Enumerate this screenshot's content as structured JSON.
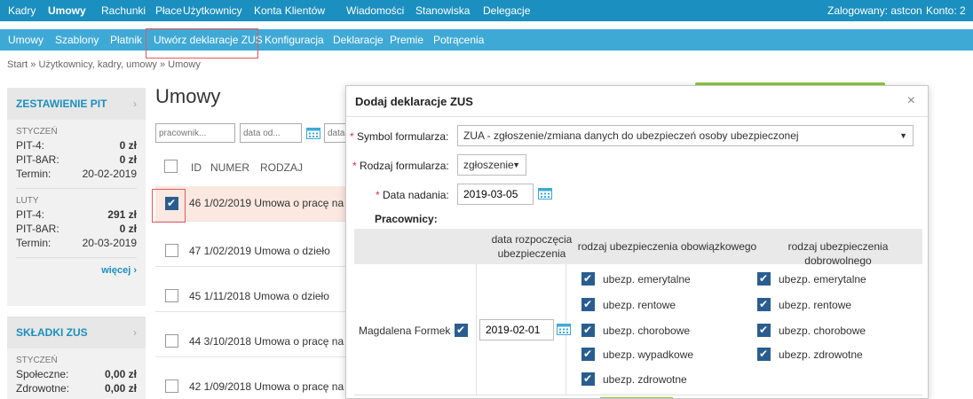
{
  "topnav": {
    "items": [
      "Kadry",
      "Umowy",
      "Rachunki",
      "Płace",
      "Użytkownicy",
      "Konta Klientów",
      "Wiadomości",
      "Stanowiska",
      "Delegacje"
    ],
    "user": "Zalogowany: astcon",
    "account": "Konto: 2"
  },
  "subnav": {
    "items": [
      "Umowy",
      "Szablony",
      "Płatnik",
      "Utwórz deklaracje ZUS",
      "Konfiguracja",
      "Deklaracje",
      "Premie",
      "Potrącenia"
    ]
  },
  "breadcrumb": "Start » Użytkownicy, kadry, umowy » Umowy",
  "pit": {
    "title": "ZESTAWIENIE PIT",
    "months": [
      {
        "name": "STYCZEŃ",
        "rows": [
          [
            "PIT-4:",
            "0 zł"
          ],
          [
            "PIT-8AR:",
            "0 zł"
          ],
          [
            "Termin:",
            "20-02-2019"
          ]
        ]
      },
      {
        "name": "LUTY",
        "rows": [
          [
            "PIT-4:",
            "291 zł"
          ],
          [
            "PIT-8AR:",
            "0 zł"
          ],
          [
            "Termin:",
            "20-03-2019"
          ]
        ]
      }
    ],
    "more": "więcej ›"
  },
  "zus": {
    "title": "SKŁADKI ZUS",
    "months": [
      {
        "name": "STYCZEŃ",
        "rows": [
          [
            "Społeczne:",
            "0,00 zł"
          ],
          [
            "Zdrowotne:",
            "0,00 zł"
          ]
        ]
      }
    ]
  },
  "page_title": "Umowy",
  "filters": {
    "worker": "pracownik...",
    "date_from": "data od...",
    "date_to": "data"
  },
  "table": {
    "headers": [
      "ID",
      "NUMER",
      "RODZAJ"
    ],
    "rows": [
      {
        "text": "46  1/02/2019 Umowa o pracę na",
        "checked": true
      },
      {
        "text": "47  1/02/2019 Umowa o dzieło",
        "checked": false
      },
      {
        "text": "45  1/11/2018 Umowa o dzieło",
        "checked": false
      },
      {
        "text": "44  3/10/2018 Umowa o pracę na",
        "checked": false
      },
      {
        "text": "42  1/09/2018 Umowa o pracę na",
        "checked": false
      }
    ]
  },
  "modal": {
    "title": "Dodaj deklaracje ZUS",
    "close": "×",
    "required_mark": "*",
    "symbol_label": "Symbol formularza:",
    "symbol_value": "ZUA - zgłoszenie/zmiana danych do ubezpieczeń osoby ubezpieczonej",
    "type_label": "Rodzaj formularza:",
    "type_value": "zgłoszenie",
    "date_label": "Data nadania:",
    "date_value": "2019-03-05",
    "workers_label": "Pracownicy:",
    "col_start_1": "data rozpoczęcia",
    "col_start_2": "ubezpieczenia",
    "col_mandatory": "rodzaj ubezpieczenia obowiązkowego",
    "col_voluntary": "rodzaj ubezpieczenia dobrowolnego",
    "worker_name": "Magdalena Formek",
    "worker_start": "2019-02-01",
    "mandatory": [
      "ubezp. emerytalne",
      "ubezp. rentowe",
      "ubezp. chorobowe",
      "ubezp. wypadkowe",
      "ubezp. zdrowotne"
    ],
    "voluntary": [
      "ubezp. emerytalne",
      "ubezp. rentowe",
      "ubezp. chorobowe",
      "ubezp. zdrowotne"
    ]
  },
  "colors": {
    "topnav": "#1b8fbf",
    "subnav": "#3fa9d6",
    "accent": "#2a5d8f",
    "green": "#8cc63f",
    "highlight": "#e05a5a"
  }
}
